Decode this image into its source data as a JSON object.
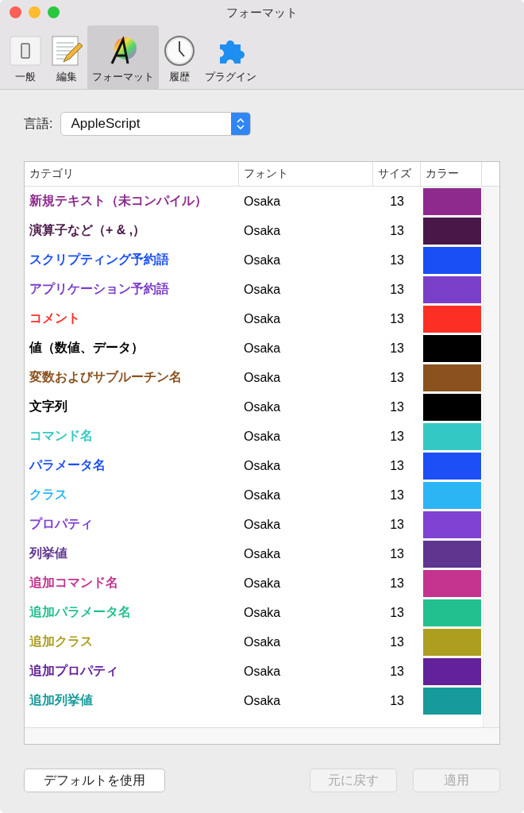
{
  "window": {
    "title": "フォーマット"
  },
  "tabs": [
    {
      "label": "一般",
      "kind": "switch",
      "selected": false
    },
    {
      "label": "編集",
      "kind": "notepad",
      "selected": false
    },
    {
      "label": "フォーマット",
      "kind": "colorwheel",
      "selected": true
    },
    {
      "label": "履歴",
      "kind": "clock",
      "selected": false
    },
    {
      "label": "プラグイン",
      "kind": "puzzle",
      "selected": false
    }
  ],
  "language": {
    "label": "言語:",
    "value": "AppleScript"
  },
  "table": {
    "columns": [
      "カテゴリ",
      "フォント",
      "サイズ",
      "カラー"
    ],
    "rows": [
      {
        "category": "新規テキスト（未コンパイル）",
        "font": "Osaka",
        "size": "13",
        "color": "#8e2a8e"
      },
      {
        "category": "演算子など（+ & ,）",
        "font": "Osaka",
        "size": "13",
        "color": "#4a1848"
      },
      {
        "category": "スクリプティング予約語",
        "font": "Osaka",
        "size": "13",
        "color": "#1a4ff5"
      },
      {
        "category": "アプリケーション予約語",
        "font": "Osaka",
        "size": "13",
        "color": "#7a3fc9"
      },
      {
        "category": "コメント",
        "font": "Osaka",
        "size": "13",
        "color": "#fc2f25"
      },
      {
        "category": "値（数値、データ）",
        "font": "Osaka",
        "size": "13",
        "color": "#000000"
      },
      {
        "category": "変数およびサブルーチン名",
        "font": "Osaka",
        "size": "13",
        "color": "#8b521f"
      },
      {
        "category": "文字列",
        "font": "Osaka",
        "size": "13",
        "color": "#000000"
      },
      {
        "category": "コマンド名",
        "font": "Osaka",
        "size": "13",
        "color": "#34c8c5"
      },
      {
        "category": "パラメータ名",
        "font": "Osaka",
        "size": "13",
        "color": "#1c4ff5"
      },
      {
        "category": "クラス",
        "font": "Osaka",
        "size": "13",
        "color": "#2cb5f5"
      },
      {
        "category": "プロパティ",
        "font": "Osaka",
        "size": "13",
        "color": "#8042d2"
      },
      {
        "category": "列挙値",
        "font": "Osaka",
        "size": "13",
        "color": "#5e3690"
      },
      {
        "category": "追加コマンド名",
        "font": "Osaka",
        "size": "13",
        "color": "#c4338e"
      },
      {
        "category": "追加パラメータ名",
        "font": "Osaka",
        "size": "13",
        "color": "#22c08f"
      },
      {
        "category": "追加クラス",
        "font": "Osaka",
        "size": "13",
        "color": "#ad9e20"
      },
      {
        "category": "追加プロパティ",
        "font": "Osaka",
        "size": "13",
        "color": "#63229a"
      },
      {
        "category": "追加列挙値",
        "font": "Osaka",
        "size": "13",
        "color": "#179a9a"
      }
    ]
  },
  "buttons": [
    {
      "label": "デフォルトを使用",
      "disabled": false
    },
    {
      "label": "元に戻す",
      "disabled": true
    },
    {
      "label": "適用",
      "disabled": true
    }
  ]
}
